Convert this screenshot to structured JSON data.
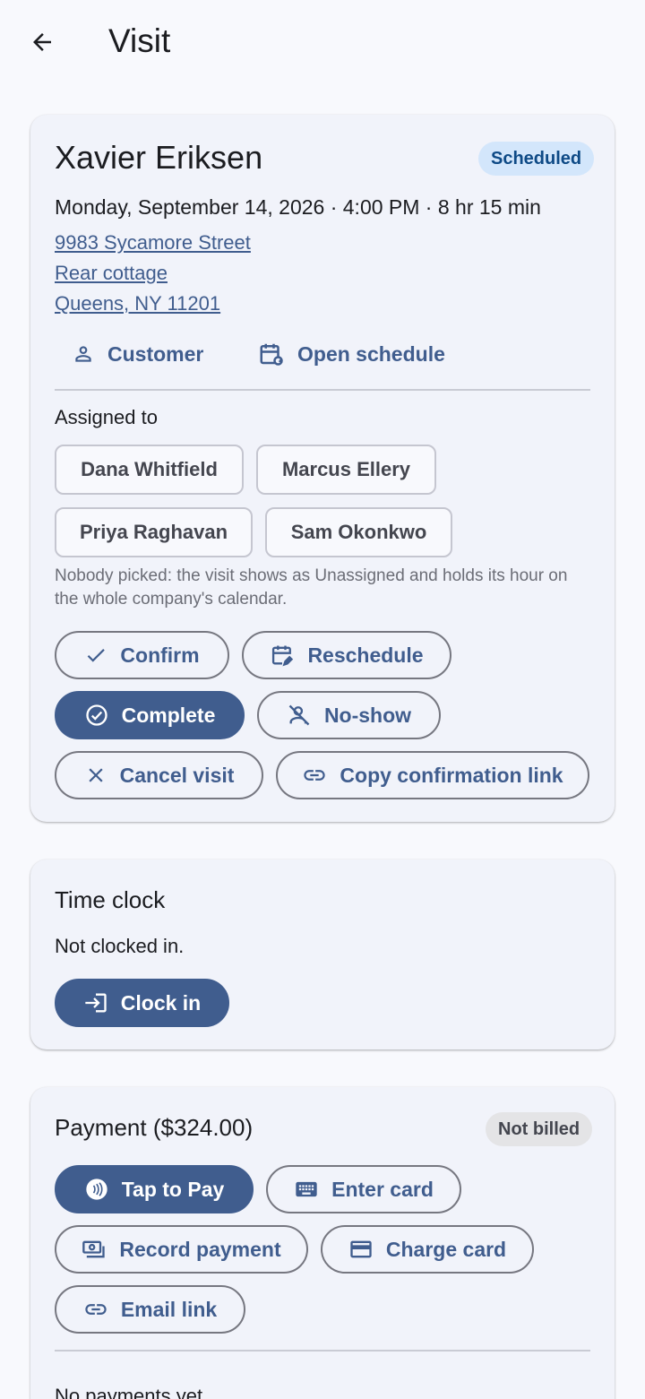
{
  "appbar": {
    "title": "Visit"
  },
  "visit": {
    "customer_name": "Xavier Eriksen",
    "status": "Scheduled",
    "datetime": "Monday, September 14, 2026 · 4:00 PM · 8 hr 15 min",
    "address": [
      "9983 Sycamore Street",
      "Rear cottage",
      "Queens, NY 11201"
    ],
    "links": {
      "customer": "Customer",
      "open_schedule": "Open schedule"
    },
    "assigned_label": "Assigned to",
    "staff": [
      "Dana Whitfield",
      "Marcus Ellery",
      "Priya Raghavan",
      "Sam Okonkwo"
    ],
    "helper": "Nobody picked: the visit shows as Unassigned and holds its hour on the whole company's calendar.",
    "actions": {
      "confirm": "Confirm",
      "reschedule": "Reschedule",
      "complete": "Complete",
      "no_show": "No-show",
      "cancel": "Cancel visit",
      "copy_link": "Copy confirmation link"
    }
  },
  "time_clock": {
    "title": "Time clock",
    "status": "Not clocked in.",
    "clock_in": "Clock in"
  },
  "payment": {
    "title": "Payment ($324.00)",
    "status": "Not billed",
    "actions": {
      "tap_to_pay": "Tap to Pay",
      "enter_card": "Enter card",
      "record_payment": "Record payment",
      "charge_card": "Charge card",
      "email_link": "Email link"
    },
    "empty": "No payments yet."
  },
  "colors": {
    "primary": "#405d8e",
    "background": "#f8f9fd",
    "card": "#f1f3fa",
    "scheduled_badge": "#d3e6fb",
    "not_billed_badge": "#e4e4e6"
  }
}
